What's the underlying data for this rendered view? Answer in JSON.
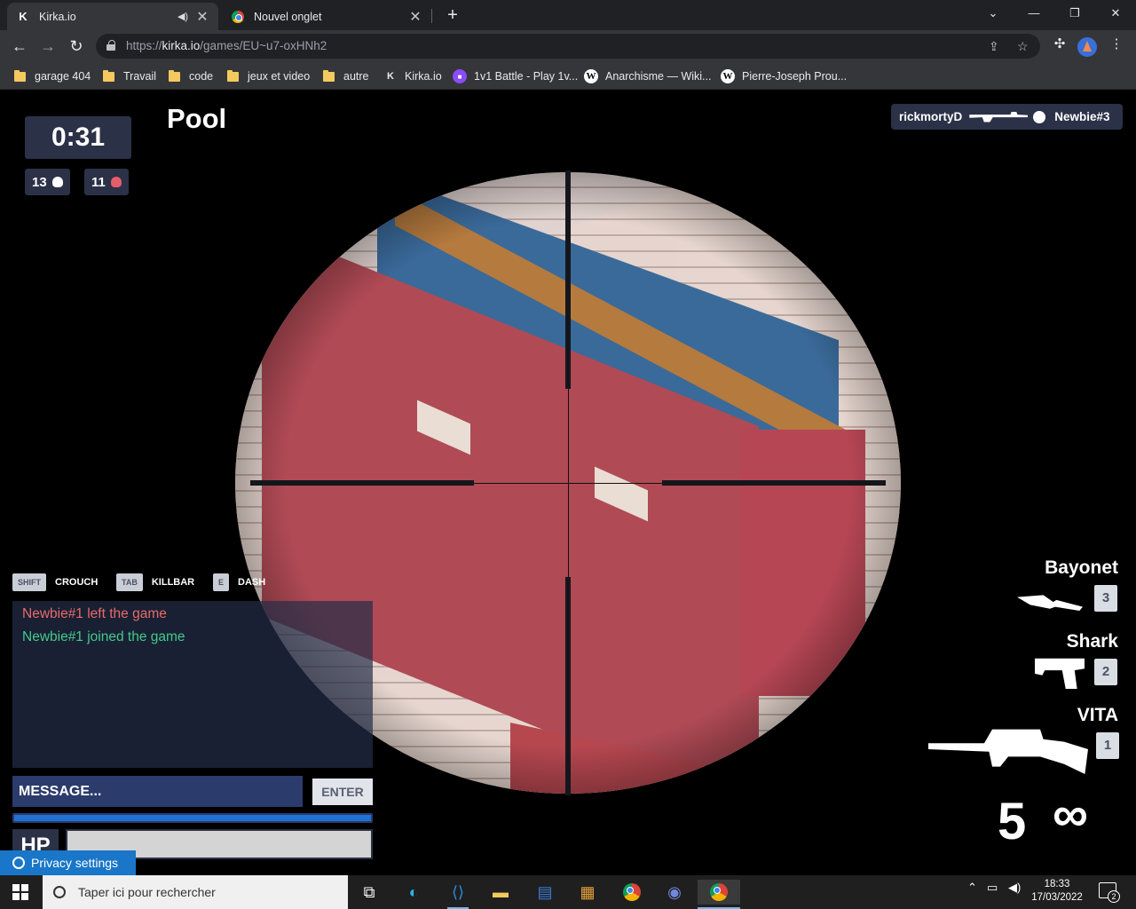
{
  "browser": {
    "tabs": [
      {
        "title": "Kirka.io",
        "favicon": "kirka-icon",
        "active": true
      },
      {
        "title": "Nouvel onglet",
        "favicon": "chrome-icon",
        "active": false
      }
    ],
    "url_prefix": "https://",
    "url_domain": "kirka.io",
    "url_path": "/games/EU~u7-oxHNh2",
    "bookmarks": [
      {
        "label": "garage 404",
        "icon": "folder-icon"
      },
      {
        "label": "Travail",
        "icon": "folder-icon"
      },
      {
        "label": "code",
        "icon": "folder-icon"
      },
      {
        "label": "jeux et video",
        "icon": "folder-icon"
      },
      {
        "label": "autre",
        "icon": "folder-icon"
      },
      {
        "label": "Kirka.io",
        "icon": "kirka-icon"
      },
      {
        "label": "1v1 Battle - Play 1v...",
        "icon": "twitch-icon"
      },
      {
        "label": "Anarchisme — Wiki...",
        "icon": "wikipedia-icon"
      },
      {
        "label": "Pierre-Joseph Prou...",
        "icon": "wikipedia-icon"
      }
    ]
  },
  "game": {
    "timer": "0:31",
    "kills": "13",
    "deaths": "11",
    "map_name": "Pool",
    "killfeed": {
      "killer": "rickmortyD",
      "victim": "Newbie#3"
    },
    "key_hints": [
      {
        "key": "SHIFT",
        "action": "CROUCH"
      },
      {
        "key": "TAB",
        "action": "KILLBAR"
      },
      {
        "key": "E",
        "action": "DASH"
      }
    ],
    "chat": [
      {
        "text": "Newbie#1 left the game",
        "type": "left"
      },
      {
        "text": "Newbie#1 joined the game",
        "type": "joined"
      }
    ],
    "message_placeholder": "MESSAGE...",
    "enter_label": "ENTER",
    "hp_label": "HP",
    "privacy_label": "Privacy settings",
    "weapons": [
      {
        "name": "Bayonet",
        "slot": "3",
        "icon": "knife-icon"
      },
      {
        "name": "Shark",
        "slot": "2",
        "icon": "pistol-icon"
      },
      {
        "name": "VITA",
        "slot": "1",
        "icon": "sniper-rifle-icon"
      }
    ],
    "ammo": "5",
    "reserve": "∞",
    "colors": {
      "hud_panel": "#2b3147",
      "chat_left": "#e86a6a",
      "chat_joined": "#43c98a",
      "accent": "#1f72d4"
    }
  },
  "taskbar": {
    "search_placeholder": "Taper ici pour rechercher",
    "time": "18:33",
    "date": "17/03/2022",
    "notification_count": "2",
    "apps": [
      "task-view-icon",
      "edge-icon",
      "vscode-icon",
      "file-explorer-icon",
      "notepad-icon",
      "rubiks-cube-icon",
      "chrome-icon",
      "discord-icon",
      "chrome-icon"
    ]
  }
}
